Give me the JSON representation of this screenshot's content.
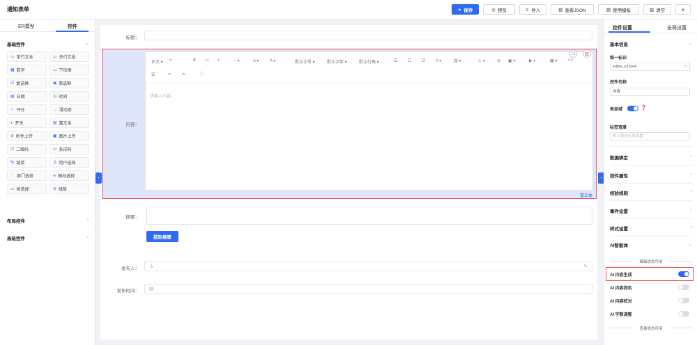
{
  "app": {
    "title": "通知表单"
  },
  "toolbar": {
    "save": "保存",
    "preview": "预览",
    "import": "导入",
    "view_json": "查看JSON",
    "use_template": "使用模板",
    "clear": "清空",
    "close": "×"
  },
  "left_panel": {
    "tabs": [
      "ER模型",
      "控件"
    ],
    "basic_section": "基础控件",
    "widgets": [
      {
        "icon": "▭",
        "label": "单行文本"
      },
      {
        "icon": "▭",
        "label": "多行文本"
      },
      {
        "icon": "▦",
        "label": "数字"
      },
      {
        "icon": "▭",
        "label": "下拉框"
      },
      {
        "icon": "☑",
        "label": "复选框"
      },
      {
        "icon": "◉",
        "label": "单选框"
      },
      {
        "icon": "▤",
        "label": "日期"
      },
      {
        "icon": "◷",
        "label": "时间"
      },
      {
        "icon": "☆",
        "label": "评分"
      },
      {
        "icon": "→",
        "label": "滑动条"
      },
      {
        "icon": "◐",
        "label": "开关"
      },
      {
        "icon": "▤",
        "label": "富文本"
      },
      {
        "icon": "⊘",
        "label": "附件上传"
      },
      {
        "icon": "▣",
        "label": "图片上传"
      },
      {
        "icon": "⊡",
        "label": "二维码"
      },
      {
        "icon": "▭",
        "label": "条形码"
      },
      {
        "icon": "%",
        "label": "链接"
      },
      {
        "icon": "♙",
        "label": "用户选择"
      },
      {
        "icon": "⋮",
        "label": "部门选择"
      },
      {
        "icon": "∞",
        "label": "图标选择"
      },
      {
        "icon": "▭",
        "label": "树选择"
      },
      {
        "icon": "⊘",
        "label": "级联"
      }
    ],
    "layout_section": "布局控件",
    "advanced_section": "高级控件"
  },
  "form": {
    "title_label": "标题：",
    "content_label": "内容：",
    "summary_label": "摘要：",
    "extract_button": "提取摘要",
    "publisher_label": "发布人：",
    "publish_time_label": "发布时间：",
    "rich_text_tag": "富文本",
    "editor": {
      "placeholder": "请输入内容...",
      "toolbar": [
        "正文 ▾",
        "❝",
        "B",
        "U",
        "I",
        "··· ▾",
        "A ▾",
        "A ▾",
        "默认字号 ▾",
        "默认字体 ▾",
        "默认行高 ▾",
        "☰",
        "☷",
        "☑",
        "≡ ▾",
        "▥ ▾",
        "☺ ▾",
        "⊘",
        "▣ ▾",
        "▶ ▾",
        "▦ ▾",
        "<>"
      ],
      "toolbar2": [
        "☰",
        "↶",
        "↷",
        "⛶"
      ]
    }
  },
  "right_panel": {
    "tabs": [
      "控件设置",
      "全局设置"
    ],
    "basic_info": "基本信息",
    "unique_id_label": "唯一标识",
    "unique_id_value": "editor_e13or4",
    "name_label": "控件名称",
    "name_value": "内容",
    "form_field_label": "表单域",
    "label_width_label": "标签宽度",
    "label_width_placeholder": "默认使用全局设置",
    "sections": [
      "数据绑定",
      "控件属性",
      "校验规则",
      "事件设置",
      "样式设置"
    ],
    "ai_section": "AI智能体",
    "edit_state_divider": "编辑状态可用",
    "ai_items": [
      {
        "label": "AI 内容生成",
        "on": true
      },
      {
        "label": "AI 内容润色",
        "on": false
      },
      {
        "label": "AI 内容校对",
        "on": false
      },
      {
        "label": "AI 字数调整",
        "on": false
      }
    ],
    "view_state_divider": "查看状态可用"
  },
  "colors": {
    "accent": "#2f6bf2",
    "highlight": "#e84b4b"
  }
}
